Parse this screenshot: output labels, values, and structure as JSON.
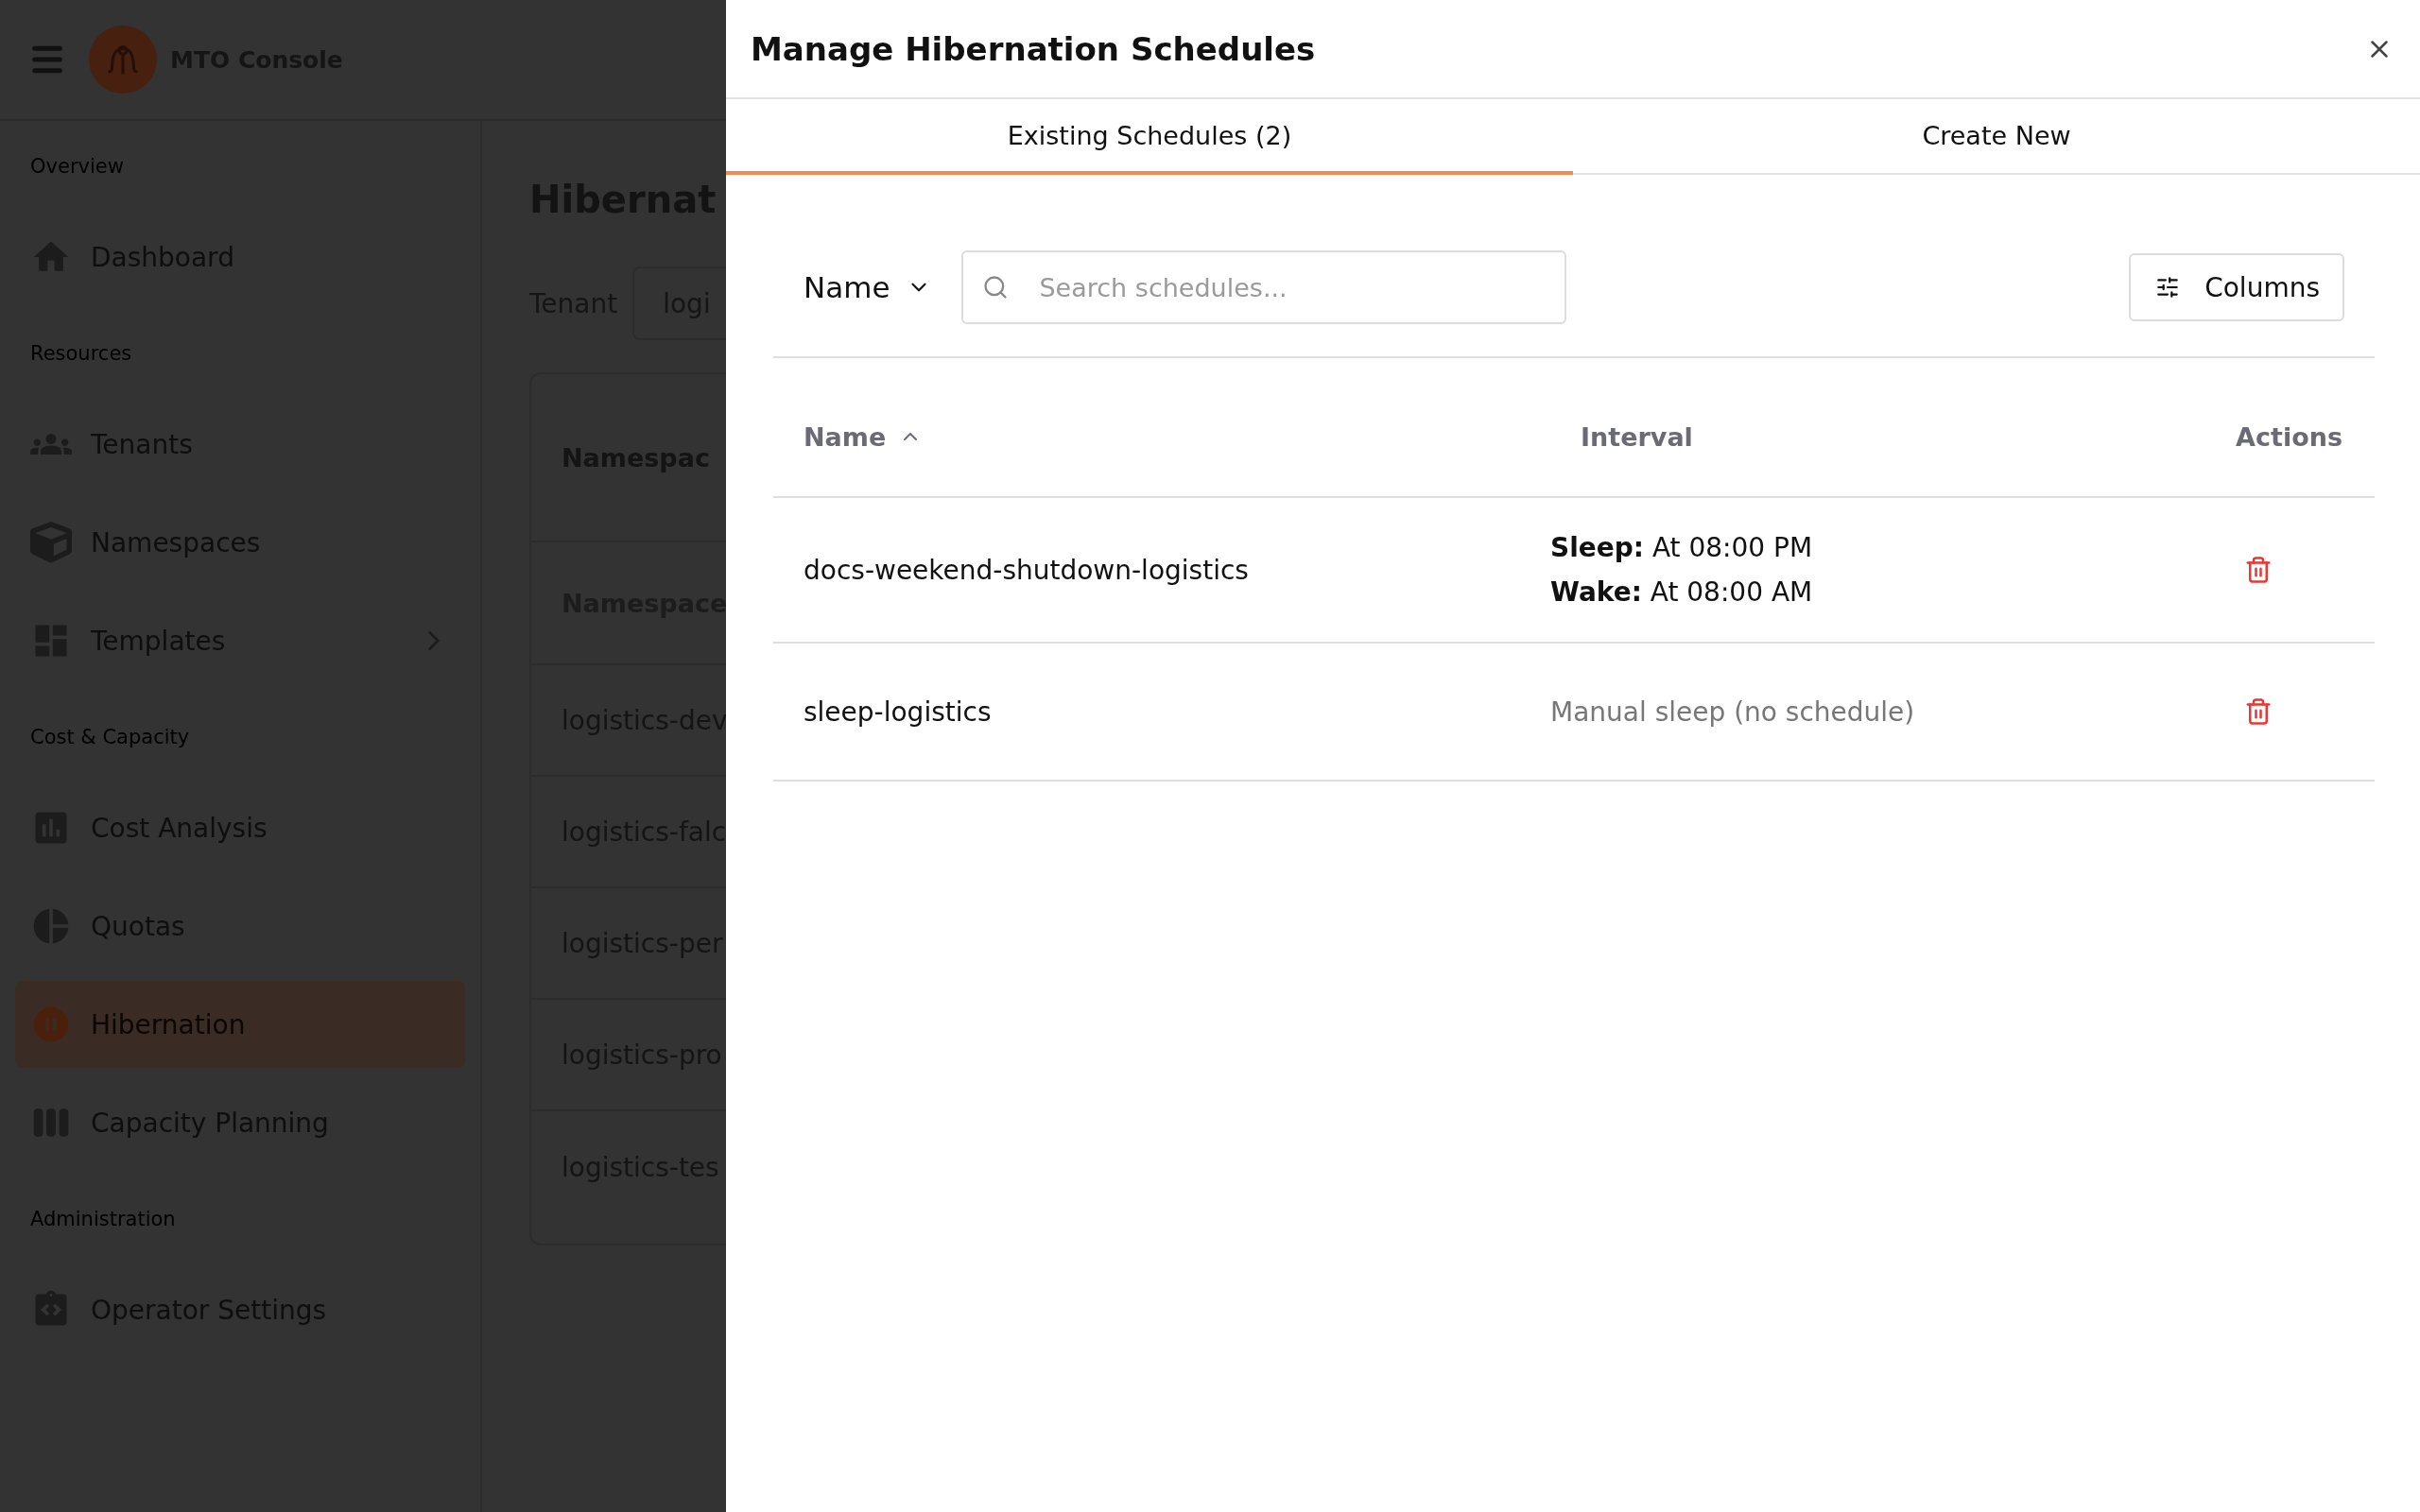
{
  "app": {
    "title": "MTO Console"
  },
  "sidebar": {
    "sections": [
      {
        "label": "Overview",
        "items": [
          {
            "label": "Dashboard",
            "selected": false,
            "expandable": false
          }
        ]
      },
      {
        "label": "Resources",
        "items": [
          {
            "label": "Tenants",
            "selected": false,
            "expandable": false
          },
          {
            "label": "Namespaces",
            "selected": false,
            "expandable": false
          },
          {
            "label": "Templates",
            "selected": false,
            "expandable": true
          }
        ]
      },
      {
        "label": "Cost & Capacity",
        "items": [
          {
            "label": "Cost Analysis",
            "selected": false,
            "expandable": false
          },
          {
            "label": "Quotas",
            "selected": false,
            "expandable": false
          },
          {
            "label": "Hibernation",
            "selected": true,
            "expandable": false
          },
          {
            "label": "Capacity Planning",
            "selected": false,
            "expandable": false
          }
        ]
      },
      {
        "label": "Administration",
        "items": [
          {
            "label": "Operator Settings",
            "selected": false,
            "expandable": false
          }
        ]
      }
    ]
  },
  "page": {
    "heading": "Hibernat",
    "tenant": {
      "label": "Tenant",
      "value": "logi"
    },
    "card": {
      "title": "Namespac",
      "column": "Namespace",
      "rows": [
        "logistics-dev",
        "logistics-falc",
        "logistics-per",
        "logistics-pro",
        "logistics-tes"
      ]
    }
  },
  "modal": {
    "title": "Manage Hibernation Schedules",
    "tabs": [
      {
        "label": "Existing Schedules (2)",
        "selected": true
      },
      {
        "label": "Create New",
        "selected": false
      }
    ],
    "filter": {
      "field": "Name",
      "placeholder": "Search schedules..."
    },
    "columns_button": "Columns",
    "table": {
      "columns": [
        {
          "label": "Name",
          "sorted": true
        },
        {
          "label": "Interval",
          "sorted": false
        },
        {
          "label": "Actions",
          "sorted": false
        }
      ],
      "rows": [
        {
          "name": "docs-weekend-shutdown-logistics",
          "interval": {
            "kind": "schedule",
            "lines": [
              "**Sleep:** At 08:00 PM",
              "**Wake:** At 08:00 AM"
            ]
          }
        },
        {
          "name": "sleep-logistics",
          "interval": {
            "kind": "manual",
            "text": "Manual sleep (no schedule)"
          }
        }
      ]
    }
  }
}
